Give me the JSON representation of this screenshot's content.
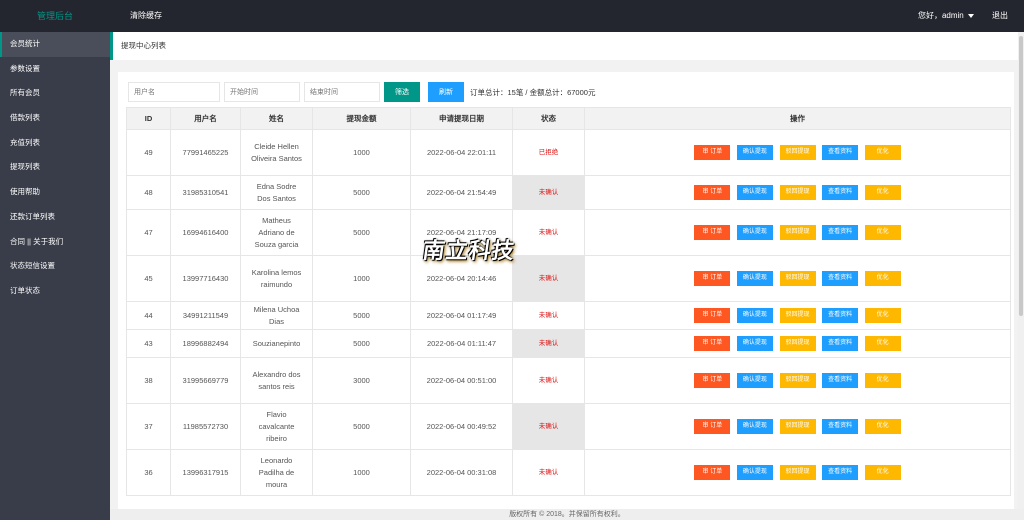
{
  "header": {
    "logo": "管理后台",
    "clear_cache": "清除缓存",
    "greeting": "您好，admin",
    "logout": "退出"
  },
  "sidebar": {
    "items": [
      {
        "label": "会员统计"
      },
      {
        "label": "参数设置"
      },
      {
        "label": "所有会员"
      },
      {
        "label": "借款列表"
      },
      {
        "label": "充值列表"
      },
      {
        "label": "提现列表"
      },
      {
        "label": "使用帮助"
      },
      {
        "label": "还款订单列表"
      },
      {
        "label": "合同 || 关于我们"
      },
      {
        "label": "状态短信设置"
      },
      {
        "label": "订单状态"
      }
    ]
  },
  "page": {
    "tab_title": "提现中心列表"
  },
  "filter": {
    "username_placeholder": "用户名",
    "start_placeholder": "开始时间",
    "end_placeholder": "结束时间",
    "filter_button": "筛选",
    "refresh_button": "刷新",
    "summary": "订单总计：15笔 / 金额总计：67000元"
  },
  "table": {
    "headers": [
      "ID",
      "用户名",
      "姓名",
      "提现金额",
      "申请提现日期",
      "状态",
      "操作"
    ],
    "actions": [
      "审 订单",
      "确认提现",
      "驳回提现",
      "查看资料",
      "优化"
    ],
    "rows": [
      {
        "id": "49",
        "username": "77991465225",
        "name": "Cleide Hellen Oliveira Santos",
        "amount": "1000",
        "date": "2022-06-04 22:01:11",
        "status": "已拒绝",
        "status_grey": false
      },
      {
        "id": "48",
        "username": "31985310541",
        "name": "Edna Sodre Dos Santos",
        "amount": "5000",
        "date": "2022-06-04 21:54:49",
        "status": "未确认",
        "status_grey": true
      },
      {
        "id": "47",
        "username": "16994616400",
        "name": "Matheus Adriano de Souza garcia",
        "amount": "5000",
        "date": "2022-06-04 21:17:09",
        "status": "未确认",
        "status_grey": false
      },
      {
        "id": "45",
        "username": "13997716430",
        "name": "Karolina lemos raimundo",
        "amount": "1000",
        "date": "2022-06-04 20:14:46",
        "status": "未确认",
        "status_grey": true
      },
      {
        "id": "44",
        "username": "34991211549",
        "name": "Milena Uchoa Dias",
        "amount": "5000",
        "date": "2022-06-04 01:17:49",
        "status": "未确认",
        "status_grey": false
      },
      {
        "id": "43",
        "username": "18996882494",
        "name": "Souzianepinto",
        "amount": "5000",
        "date": "2022-06-04 01:11:47",
        "status": "未确认",
        "status_grey": true
      },
      {
        "id": "38",
        "username": "31995669779",
        "name": "Alexandro dos santos reis",
        "amount": "3000",
        "date": "2022-06-04 00:51:00",
        "status": "未确认",
        "status_grey": false
      },
      {
        "id": "37",
        "username": "11985572730",
        "name": "Flavio cavalcante ribeiro",
        "amount": "5000",
        "date": "2022-06-04 00:49:52",
        "status": "未确认",
        "status_grey": true
      },
      {
        "id": "36",
        "username": "13996317915",
        "name": "Leonardo Padilha de moura",
        "amount": "1000",
        "date": "2022-06-04 00:31:08",
        "status": "未确认",
        "status_grey": false
      }
    ]
  },
  "watermark": "南立科技",
  "footer": "版权所有 © 2018。并保留所有权利。"
}
